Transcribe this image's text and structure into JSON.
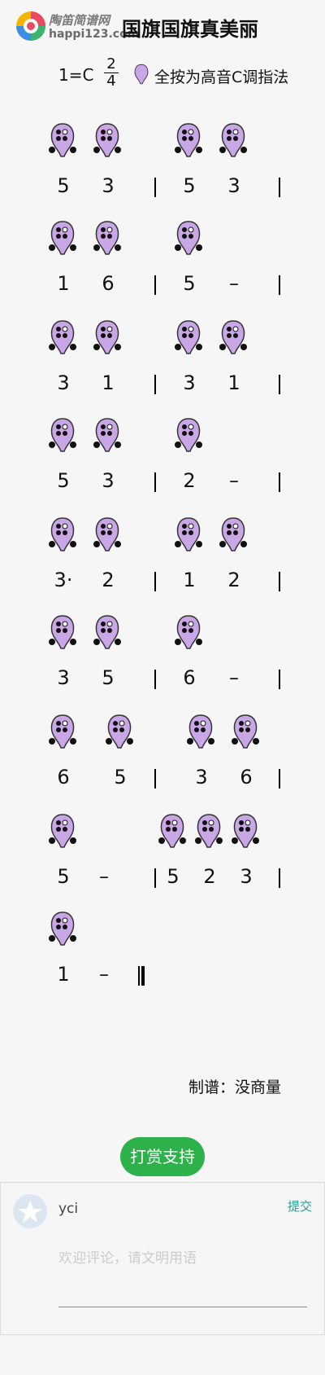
{
  "header": {
    "logo_text_top": "陶笛简谱网",
    "logo_text_bottom": "happi123.com",
    "title": "国旗国旗真美丽",
    "key": "1=C",
    "time_top": "2",
    "time_bottom": "4",
    "hint": "全按为高音C调指法"
  },
  "systems": [
    {
      "notes": [
        "5",
        "3",
        "5",
        "3"
      ]
    },
    {
      "notes": [
        "1",
        "6",
        "5",
        "–"
      ]
    },
    {
      "notes": [
        "3",
        "1",
        "3",
        "1"
      ]
    },
    {
      "notes": [
        "5",
        "3",
        "2",
        "–"
      ]
    },
    {
      "notes": [
        "3·",
        "2",
        "1",
        "2"
      ]
    },
    {
      "notes": [
        "3",
        "5",
        "6",
        "–"
      ]
    },
    {
      "notes": [
        "6",
        "5",
        "3",
        "6"
      ]
    },
    {
      "notes": [
        "5",
        "–",
        "5",
        "2",
        "3"
      ]
    },
    {
      "notes": [
        "1",
        "–"
      ]
    }
  ],
  "footer": {
    "author": "制谱：没商量",
    "reward_button": "打赏支持",
    "comment_user": "yci",
    "submit_label": "提交",
    "comment_placeholder": "欢迎评论，请文明用语"
  },
  "colors": {
    "ocarina_fill": "#c9a6e6",
    "reward_green": "#2db14a"
  }
}
